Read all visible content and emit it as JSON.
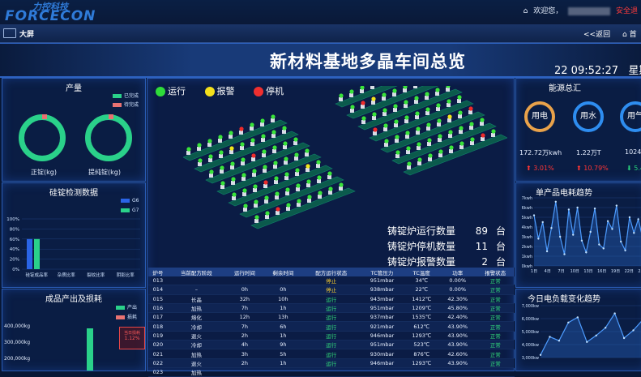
{
  "header": {
    "logo_cn": "力控科技",
    "logo_en": "FORCECON",
    "greeting": "欢迎您，",
    "safe_exit": "安全退"
  },
  "nav": {
    "title": "大屏",
    "back": "<<返回",
    "home": "首"
  },
  "page": {
    "title": "新材料基地多晶车间总览",
    "time": "22 09:52:27",
    "weekday": "星期"
  },
  "output_panel": {
    "title": "产量",
    "legend": [
      "已完成",
      "待完成"
    ],
    "labels": [
      "正锭(kg)",
      "提纯锭(kg)"
    ],
    "colors": {
      "done": "#2ad18a",
      "pending": "#e87272"
    }
  },
  "silicon_panel": {
    "title": "硅锭检测数据",
    "legend": [
      "G6",
      "G7"
    ],
    "y_ticks": [
      "100%",
      "80%",
      "60%",
      "40%",
      "20%",
      "0%"
    ],
    "categories": [
      "硅锭成品率",
      "杂质比率",
      "裂纹比率",
      "阴影比率"
    ],
    "chart_data": {
      "type": "bar",
      "categories": [
        "硅锭成品率",
        "杂质比率",
        "裂纹比率",
        "阴影比率"
      ],
      "series": [
        {
          "name": "G6",
          "values": [
            60,
            0,
            0,
            0
          ]
        },
        {
          "name": "G7",
          "values": [
            60,
            0,
            0,
            0
          ]
        }
      ],
      "ylim": [
        0,
        100
      ]
    }
  },
  "product_panel": {
    "title": "成品产出及损耗",
    "legend": [
      "产出",
      "损耗"
    ],
    "y_ticks": [
      "400,000kg",
      "300,000kg",
      "200,000kg"
    ],
    "tooltip": {
      "title": "当日损耗",
      "value": "1.12%"
    }
  },
  "status_legend": [
    {
      "label": "运行",
      "color": "#2fdc3a"
    },
    {
      "label": "报警",
      "color": "#f4e01c"
    },
    {
      "label": "停机",
      "color": "#ef2f2f"
    }
  ],
  "stats": [
    {
      "label": "铸锭炉运行数量",
      "value": "89",
      "unit": "台"
    },
    {
      "label": "铸锭炉停机数量",
      "value": "11",
      "unit": "台"
    },
    {
      "label": "铸锭炉报警数量",
      "value": "2",
      "unit": "台"
    }
  ],
  "table": {
    "columns": [
      "炉号",
      "当前配方阶段",
      "运行时间",
      "剩余时间",
      "配方运行状态",
      "TC管压力",
      "TC温度",
      "功率",
      "报警状态"
    ],
    "rows": [
      [
        "013",
        "",
        "",
        "",
        "停止",
        "951mbar",
        "34℃",
        "0.00%",
        "正常"
      ],
      [
        "014",
        "–",
        "0h",
        "0h",
        "停止",
        "938mbar",
        "22℃",
        "0.00%",
        "正常"
      ],
      [
        "015",
        "长晶",
        "32h",
        "10h",
        "运行",
        "943mbar",
        "1412℃",
        "42.30%",
        "正常"
      ],
      [
        "016",
        "加热",
        "7h",
        "1h",
        "运行",
        "951mbar",
        "1209℃",
        "45.80%",
        "正常"
      ],
      [
        "017",
        "熔化",
        "12h",
        "13h",
        "运行",
        "937mbar",
        "1535℃",
        "42.40%",
        "正常"
      ],
      [
        "018",
        "冷却",
        "7h",
        "6h",
        "运行",
        "921mbar",
        "612℃",
        "43.90%",
        "正常"
      ],
      [
        "019",
        "退火",
        "2h",
        "1h",
        "运行",
        "946mbar",
        "1293℃",
        "43.90%",
        "正常"
      ],
      [
        "020",
        "冷却",
        "4h",
        "9h",
        "运行",
        "951mbar",
        "523℃",
        "43.90%",
        "正常"
      ],
      [
        "021",
        "加热",
        "3h",
        "5h",
        "运行",
        "930mbar",
        "876℃",
        "42.60%",
        "正常"
      ],
      [
        "022",
        "退火",
        "2h",
        "1h",
        "运行",
        "946mbar",
        "1293℃",
        "43.90%",
        "正常"
      ],
      [
        "023",
        "加热",
        "",
        "",
        "",
        "",
        "",
        "",
        ""
      ]
    ]
  },
  "energy_panel": {
    "title": "能源总汇",
    "items": [
      {
        "name": "用电",
        "value": "172.72万kwh",
        "change": "3.01%"
      },
      {
        "name": "用水",
        "value": "1.22万T",
        "change": "10.79%"
      },
      {
        "name": "用气",
        "value": "1024",
        "change": "5.4"
      }
    ]
  },
  "unit_power_panel": {
    "title": "单产品电耗趋势",
    "y_ticks": [
      "7kwh",
      "6kwh",
      "5kwh",
      "4kwh",
      "3kwh",
      "2kwh",
      "1kwh",
      "0kwh"
    ],
    "x_ticks": [
      "1日",
      "4日",
      "7日",
      "10日",
      "13日",
      "16日",
      "19日",
      "22日",
      "25日"
    ],
    "chart_data": {
      "type": "area",
      "x": [
        "1日",
        "2日",
        "3日",
        "4日",
        "5日",
        "6日",
        "7日",
        "8日",
        "9日",
        "10日",
        "11日",
        "12日",
        "13日",
        "14日",
        "15日",
        "16日",
        "17日",
        "18日",
        "19日",
        "20日",
        "21日",
        "22日",
        "23日",
        "24日",
        "25日",
        "26日"
      ],
      "y": [
        5.2,
        2.8,
        4.5,
        1.5,
        3.9,
        6.6,
        3.0,
        1.2,
        5.8,
        3.2,
        6.0,
        2.6,
        1.4,
        3.5,
        5.9,
        2.2,
        1.8,
        4.6,
        3.8,
        6.2,
        2.5,
        1.6,
        5.0,
        3.4,
        4.8,
        2.9
      ],
      "ylim": [
        0,
        7
      ]
    }
  },
  "daily_power_panel": {
    "title": "今日电负载变化趋势",
    "y_ticks": [
      "7,000kw",
      "6,000kw",
      "5,000kw",
      "4,000kw",
      "3,000kw"
    ],
    "chart_data": {
      "type": "area",
      "x": [
        1,
        2,
        3,
        4,
        5,
        6,
        7,
        8,
        9,
        10,
        11,
        12
      ],
      "y": [
        3200,
        4600,
        4300,
        5700,
        6100,
        4200,
        4700,
        5300,
        6400,
        4500,
        5100,
        5900
      ],
      "ylim": [
        3000,
        7000
      ]
    }
  }
}
